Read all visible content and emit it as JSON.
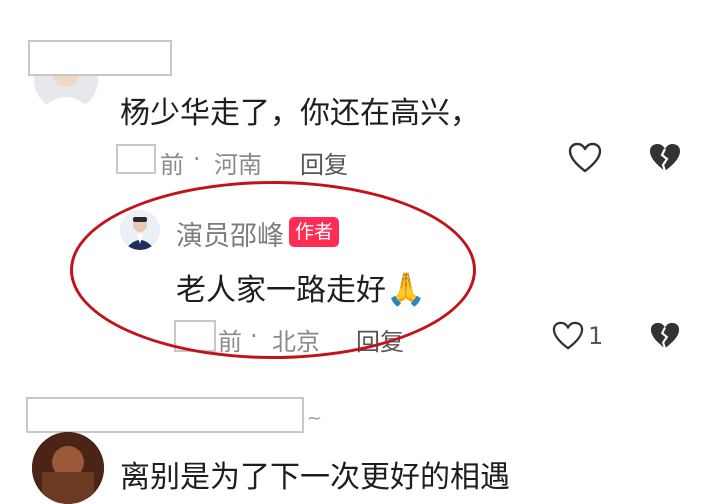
{
  "comments": [
    {
      "text": "杨少华走了，你还在高兴，",
      "time": "前",
      "separator": "·",
      "location": "河南",
      "reply_label": "回复"
    },
    {
      "author": "演员邵峰",
      "author_badge": "作者",
      "text": "老人家一路走好",
      "emoji": "🙏",
      "time": "前",
      "separator": "·",
      "location": "北京",
      "reply_label": "回复",
      "like_count": "1"
    },
    {
      "name_suffix": "~",
      "text": "离别是为了下一次更好的相遇"
    }
  ],
  "icons": {
    "like": "heart-outline-icon",
    "dislike": "broken-heart-icon"
  },
  "colors": {
    "badge": "#ff2d55",
    "annotation_oval": "#c4121b"
  }
}
